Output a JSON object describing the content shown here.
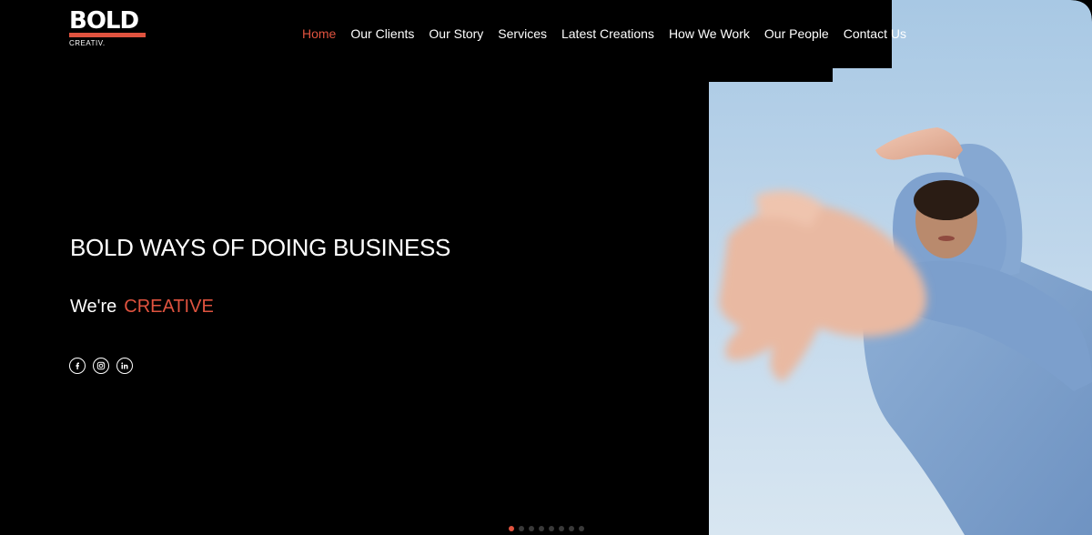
{
  "brand": {
    "logo_word": "BOLD",
    "logo_sub": "CREATIV.",
    "accent_color": "#e0533f"
  },
  "nav": {
    "items": [
      {
        "label": "Home",
        "active": true
      },
      {
        "label": "Our Clients",
        "active": false
      },
      {
        "label": "Our Story",
        "active": false
      },
      {
        "label": "Services",
        "active": false
      },
      {
        "label": "Latest Creations",
        "active": false
      },
      {
        "label": "How We Work",
        "active": false
      },
      {
        "label": "Our People",
        "active": false
      },
      {
        "label": "Contact Us",
        "active": false
      }
    ]
  },
  "hero": {
    "headline": "BOLD WAYS OF DOING BUSINESS",
    "tagline_prefix": "We're",
    "tagline_accent": "CREATIVE"
  },
  "social": {
    "icons": [
      "facebook-icon",
      "instagram-icon",
      "linkedin-icon"
    ]
  },
  "slider": {
    "total_slides": 8,
    "active_index": 0
  }
}
